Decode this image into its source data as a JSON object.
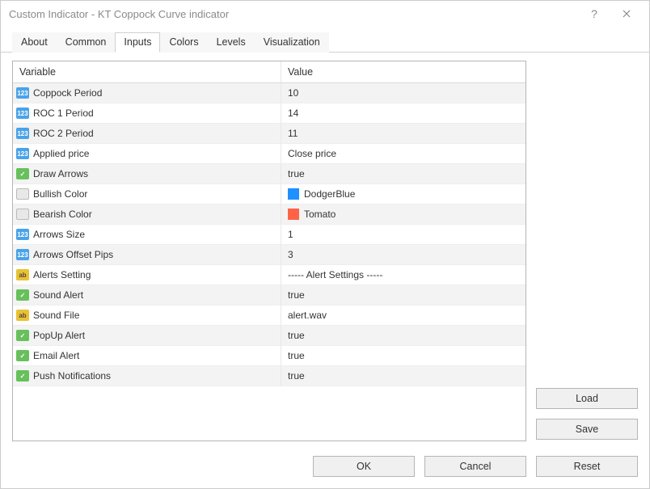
{
  "title": "Custom Indicator - KT Coppock Curve indicator",
  "tabs": [
    "About",
    "Common",
    "Inputs",
    "Colors",
    "Levels",
    "Visualization"
  ],
  "activeTab": 2,
  "columns": {
    "variable": "Variable",
    "value": "Value"
  },
  "rows": [
    {
      "icon": "int",
      "label": "Coppock Period",
      "value": "10"
    },
    {
      "icon": "int",
      "label": "ROC 1 Period",
      "value": "14"
    },
    {
      "icon": "int",
      "label": "ROC 2 Period",
      "value": "11"
    },
    {
      "icon": "int",
      "label": "Applied price",
      "value": "Close price"
    },
    {
      "icon": "bool",
      "label": "Draw Arrows",
      "value": "true"
    },
    {
      "icon": "clr",
      "label": "Bullish Color",
      "value": "DodgerBlue",
      "swatch": "#1e90ff"
    },
    {
      "icon": "clr",
      "label": "Bearish Color",
      "value": "Tomato",
      "swatch": "#ff6347"
    },
    {
      "icon": "int",
      "label": "Arrows Size",
      "value": "1"
    },
    {
      "icon": "int",
      "label": "Arrows Offset Pips",
      "value": "3"
    },
    {
      "icon": "str",
      "label": "Alerts Setting",
      "value": "----- Alert Settings -----"
    },
    {
      "icon": "bool",
      "label": "Sound Alert",
      "value": "true"
    },
    {
      "icon": "str",
      "label": "Sound File",
      "value": "alert.wav"
    },
    {
      "icon": "bool",
      "label": "PopUp Alert",
      "value": "true"
    },
    {
      "icon": "bool",
      "label": "Email Alert",
      "value": "true"
    },
    {
      "icon": "bool",
      "label": "Push Notifications",
      "value": "true"
    }
  ],
  "buttons": {
    "load": "Load",
    "save": "Save",
    "ok": "OK",
    "cancel": "Cancel",
    "reset": "Reset"
  }
}
